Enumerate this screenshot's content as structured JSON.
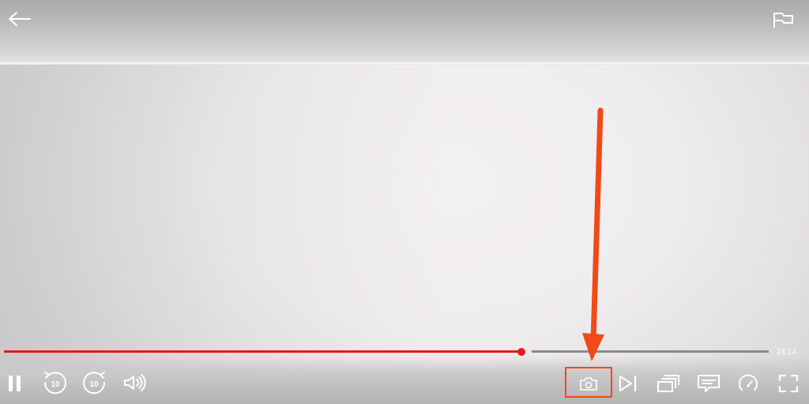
{
  "player": {
    "time_remaining": "24:14",
    "progress_fraction": 0.675
  },
  "icons": {
    "back": "arrow-left-icon",
    "report": "flag-icon",
    "pause": "pause-icon",
    "rewind": "rewind-10-icon",
    "forward": "forward-10-icon",
    "volume": "volume-icon",
    "screenshot": "camera-icon",
    "next": "next-episode-icon",
    "episodes": "episodes-icon",
    "subtitles": "subtitles-icon",
    "speed": "speed-icon",
    "fullscreen": "fullscreen-icon"
  },
  "skip": {
    "rewind_seconds": "10",
    "forward_seconds": "10"
  },
  "colors": {
    "progress_played": "#e31b12",
    "progress_remaining": "#8a8a8a",
    "annotation": "#ef4a17",
    "icon": "#ffffff"
  }
}
